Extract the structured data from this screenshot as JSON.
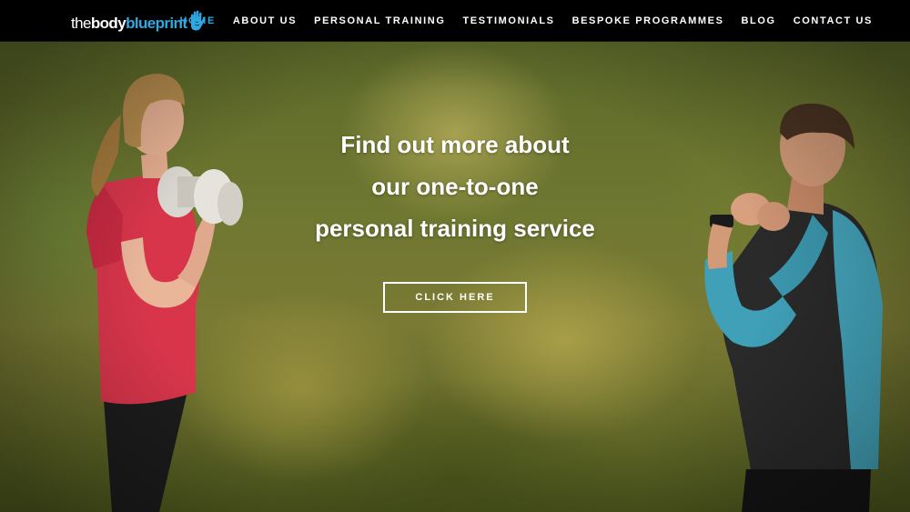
{
  "brand": {
    "logo_the": "the",
    "logo_body": "body",
    "logo_blueprint": "blueprint",
    "accent_color": "#2fa8e0",
    "logo_icon": "hand-icon"
  },
  "nav": {
    "items": [
      {
        "label": "HOME",
        "active": true
      },
      {
        "label": "ABOUT US",
        "active": false
      },
      {
        "label": "PERSONAL TRAINING",
        "active": false
      },
      {
        "label": "TESTIMONIALS",
        "active": false
      },
      {
        "label": "BESPOKE PROGRAMMES",
        "active": false
      },
      {
        "label": "BLOG",
        "active": false
      },
      {
        "label": "CONTACT US",
        "active": false
      }
    ]
  },
  "hero": {
    "heading_lines": [
      "Find out more about",
      "our one-to-one",
      "personal training service"
    ],
    "cta_label": "CLICK HERE"
  }
}
